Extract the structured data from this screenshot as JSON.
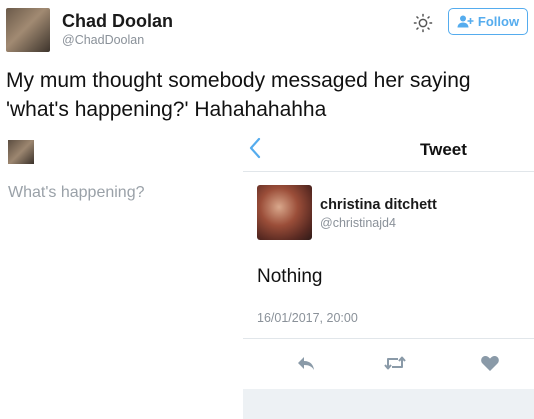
{
  "header": {
    "name": "Chad Doolan",
    "handle": "@ChadDoolan",
    "follow_label": "Follow",
    "icons": {
      "settings": "gear-icon",
      "follow": "add-user-icon"
    }
  },
  "tweet": {
    "text": "My mum thought somebody messaged her saying 'what's happening?' Hahahahahha"
  },
  "composer": {
    "placeholder": "What's happening?"
  },
  "embedded_tweet": {
    "nav_title": "Tweet",
    "author_name": "christina ditchett",
    "author_handle": "@christinajd4",
    "text": "Nothing",
    "timestamp": "16/01/2017, 20:00",
    "actions": [
      "reply-icon",
      "retweet-icon",
      "like-icon"
    ]
  },
  "colors": {
    "accent": "#55acee",
    "secondary_text": "#8a9199",
    "icon_gray": "#8a9aa8"
  }
}
